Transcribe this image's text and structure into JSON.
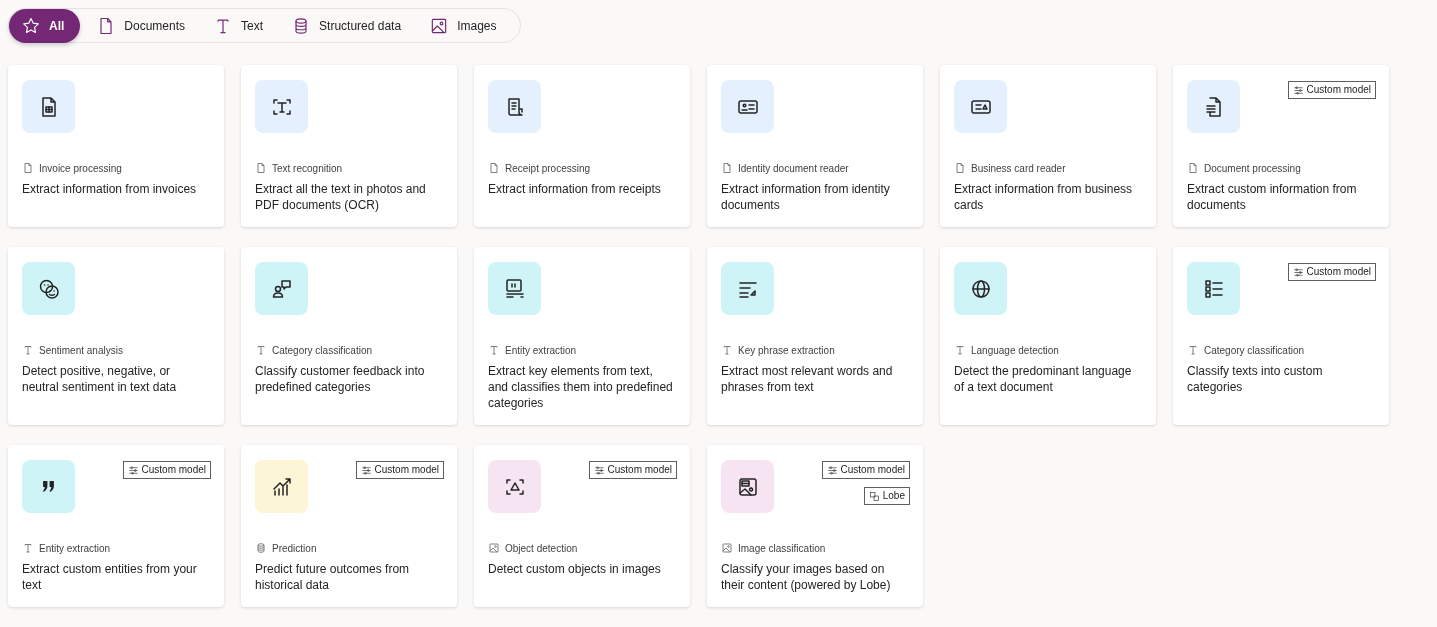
{
  "filters": [
    {
      "kind": "all",
      "label": "All",
      "selected": true
    },
    {
      "kind": "document",
      "label": "Documents",
      "selected": false
    },
    {
      "kind": "text",
      "label": "Text",
      "selected": false
    },
    {
      "kind": "data",
      "label": "Structured data",
      "selected": false
    },
    {
      "kind": "image",
      "label": "Images",
      "selected": false
    }
  ],
  "cards": [
    {
      "color": "#e5f0ff",
      "category": {
        "kind": "document",
        "text": "Invoice processing"
      },
      "title": "Extract information from invoices"
    },
    {
      "color": "#e5f0ff",
      "category": {
        "kind": "document",
        "text": "Text recognition"
      },
      "title": "Extract all the text in photos and PDF documents (OCR)"
    },
    {
      "color": "#e5f0ff",
      "category": {
        "kind": "document",
        "text": "Receipt processing"
      },
      "title": "Extract information from receipts"
    },
    {
      "color": "#e5f0ff",
      "category": {
        "kind": "document",
        "text": "Identity document reader"
      },
      "title": "Extract information from identity documents"
    },
    {
      "color": "#e5f0ff",
      "category": {
        "kind": "document",
        "text": "Business card reader"
      },
      "title": "Extract information from business cards"
    },
    {
      "color": "#e5f0ff",
      "category": {
        "kind": "document",
        "text": "Document processing"
      },
      "title": "Extract custom information from documents",
      "badges": [
        {
          "kind": "custom",
          "label": "Custom model"
        }
      ]
    },
    {
      "color": "#cff4f8",
      "category": {
        "kind": "text",
        "text": "Sentiment analysis"
      },
      "title": "Detect positive, negative, or neutral sentiment in text data"
    },
    {
      "color": "#cff4f8",
      "category": {
        "kind": "text",
        "text": "Category classification"
      },
      "title": "Classify customer feedback into predefined categories"
    },
    {
      "color": "#cff4f8",
      "category": {
        "kind": "text",
        "text": "Entity extraction"
      },
      "title": "Extract key elements from text, and classifies them into predefined categories"
    },
    {
      "color": "#cff4f8",
      "category": {
        "kind": "text",
        "text": "Key phrase extraction"
      },
      "title": "Extract most relevant words and phrases from text"
    },
    {
      "color": "#cff4f8",
      "category": {
        "kind": "text",
        "text": "Language detection"
      },
      "title": "Detect the predominant language of a text document"
    },
    {
      "color": "#cff4f8",
      "category": {
        "kind": "text",
        "text": "Category classification"
      },
      "title": "Classify texts into custom categories",
      "badges": [
        {
          "kind": "custom",
          "label": "Custom model"
        }
      ]
    },
    {
      "color": "#cff4f8",
      "category": {
        "kind": "text",
        "text": "Entity extraction"
      },
      "title": "Extract custom entities from your text",
      "badges": [
        {
          "kind": "custom",
          "label": "Custom model"
        }
      ]
    },
    {
      "color": "#fdf6d6",
      "category": {
        "kind": "data",
        "text": "Prediction"
      },
      "title": "Predict future outcomes from historical data",
      "badges": [
        {
          "kind": "custom",
          "label": "Custom model"
        }
      ]
    },
    {
      "color": "#f7e4f3",
      "category": {
        "kind": "image",
        "text": "Object detection"
      },
      "title": "Detect custom objects in images",
      "badges": [
        {
          "kind": "custom",
          "label": "Custom model"
        }
      ]
    },
    {
      "color": "#f7e4f3",
      "category": {
        "kind": "image",
        "text": "Image classification"
      },
      "title": "Classify your images based on their content (powered by Lobe)",
      "badges": [
        {
          "kind": "custom",
          "label": "Custom model"
        },
        {
          "kind": "lobe",
          "label": "Lobe"
        }
      ]
    }
  ]
}
